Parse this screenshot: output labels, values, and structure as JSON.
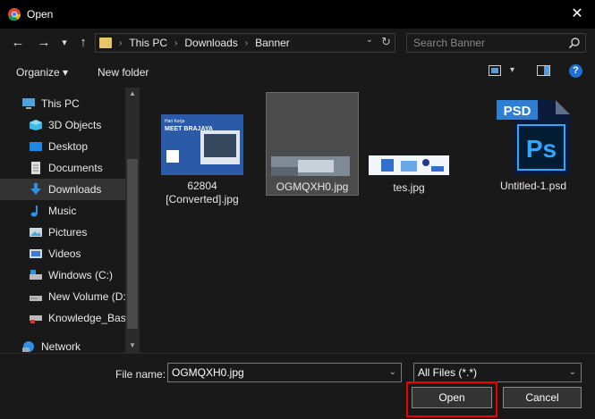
{
  "window": {
    "title": "Open",
    "close_glyph": "✕"
  },
  "nav_buttons": {
    "back": "←",
    "forward": "→",
    "recent": "▾",
    "up": "↑"
  },
  "address": {
    "crumbs": [
      "This PC",
      "Downloads",
      "Banner"
    ],
    "sep": "›",
    "dropdown": "⌄",
    "refresh": "↻"
  },
  "search": {
    "placeholder": "Search Banner"
  },
  "toolbar": {
    "organize": "Organize ▾",
    "new_folder": "New folder",
    "view_dd": "▾",
    "help": "?"
  },
  "sidebar": {
    "items": [
      {
        "label": "This PC",
        "icon": "pc-icon"
      },
      {
        "label": "3D Objects",
        "icon": "cube-icon"
      },
      {
        "label": "Desktop",
        "icon": "desktop-icon"
      },
      {
        "label": "Documents",
        "icon": "document-icon"
      },
      {
        "label": "Downloads",
        "icon": "download-icon",
        "selected": true
      },
      {
        "label": "Music",
        "icon": "music-icon"
      },
      {
        "label": "Pictures",
        "icon": "picture-icon"
      },
      {
        "label": "Videos",
        "icon": "video-icon"
      },
      {
        "label": "Windows (C:)",
        "icon": "drive-icon"
      },
      {
        "label": "New Volume (D:",
        "icon": "drive-icon"
      },
      {
        "label": "Knowledge_Base",
        "icon": "network-drive-icon"
      },
      {
        "label": "Network",
        "icon": "network-icon"
      }
    ]
  },
  "thumbnail_text": {
    "banner_line1": "Hari Kerja",
    "banner_line2": "MEET BRAJAYA",
    "psd_badge": "PSD",
    "ps_logo": "Ps"
  },
  "files": [
    {
      "label_line1": "62804",
      "label_line2": "[Converted].jpg"
    },
    {
      "label_line1": "OGMQXH0.jpg",
      "label_line2": "",
      "selected": true
    },
    {
      "label_line1": "tes.jpg",
      "label_line2": ""
    },
    {
      "label_line1": "Untitled-1.psd",
      "label_line2": ""
    }
  ],
  "footer": {
    "file_name_label": "File name:",
    "file_name_value": "OGMQXH0.jpg",
    "file_type_value": "All Files (*.*)",
    "open_label": "Open",
    "cancel_label": "Cancel",
    "dropdown_glyph": "⌄"
  },
  "colors": {
    "accent": "#0078d7",
    "highlight": "#e00000"
  }
}
